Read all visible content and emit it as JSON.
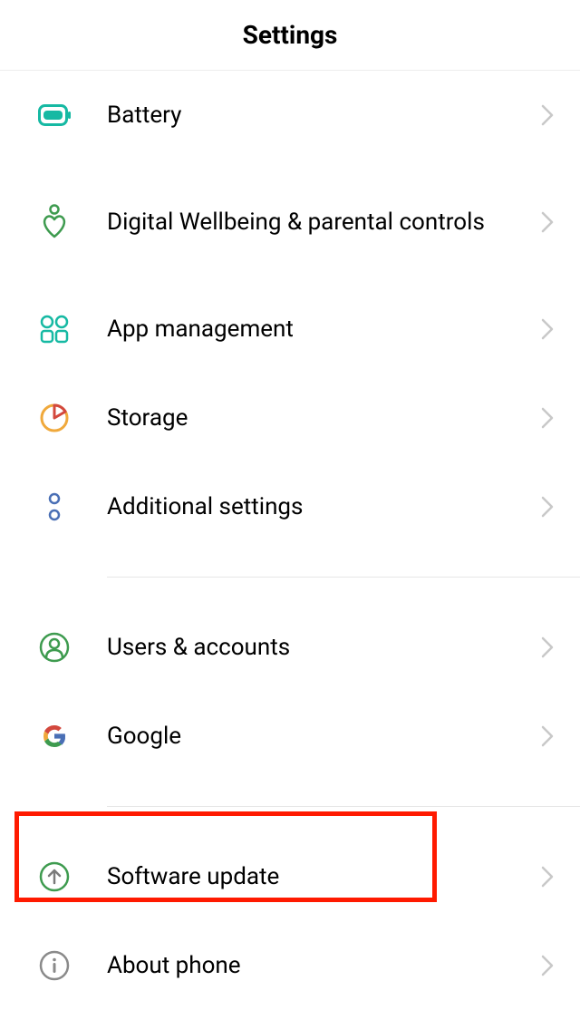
{
  "header": {
    "title": "Settings"
  },
  "items": {
    "battery": {
      "label": "Battery"
    },
    "digital_wellbeing": {
      "label": "Digital Wellbeing & parental controls"
    },
    "app_management": {
      "label": "App management"
    },
    "storage": {
      "label": "Storage"
    },
    "additional": {
      "label": "Additional settings"
    },
    "users_accounts": {
      "label": "Users & accounts"
    },
    "google": {
      "label": "Google"
    },
    "software_update": {
      "label": "Software update"
    },
    "about_phone": {
      "label": "About phone"
    }
  }
}
